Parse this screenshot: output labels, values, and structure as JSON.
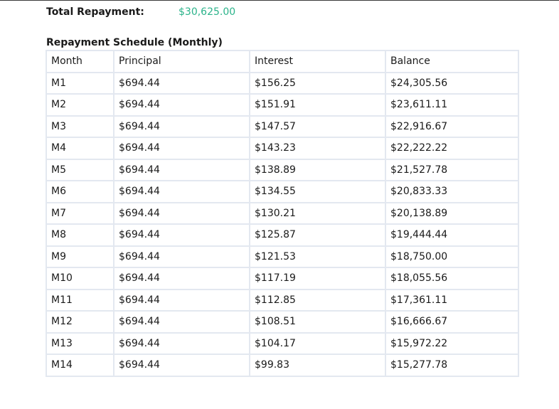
{
  "summary": {
    "total_repayment_label": "Total Repayment:",
    "total_repayment_value": "$30,625.00"
  },
  "schedule": {
    "title": "Repayment Schedule (Monthly)",
    "columns": [
      "Month",
      "Principal",
      "Interest",
      "Balance"
    ],
    "rows": [
      [
        "M1",
        "$694.44",
        "$156.25",
        "$24,305.56"
      ],
      [
        "M2",
        "$694.44",
        "$151.91",
        "$23,611.11"
      ],
      [
        "M3",
        "$694.44",
        "$147.57",
        "$22,916.67"
      ],
      [
        "M4",
        "$694.44",
        "$143.23",
        "$22,222.22"
      ],
      [
        "M5",
        "$694.44",
        "$138.89",
        "$21,527.78"
      ],
      [
        "M6",
        "$694.44",
        "$134.55",
        "$20,833.33"
      ],
      [
        "M7",
        "$694.44",
        "$130.21",
        "$20,138.89"
      ],
      [
        "M8",
        "$694.44",
        "$125.87",
        "$19,444.44"
      ],
      [
        "M9",
        "$694.44",
        "$121.53",
        "$18,750.00"
      ],
      [
        "M10",
        "$694.44",
        "$117.19",
        "$18,055.56"
      ],
      [
        "M11",
        "$694.44",
        "$112.85",
        "$17,361.11"
      ],
      [
        "M12",
        "$694.44",
        "$108.51",
        "$16,666.67"
      ],
      [
        "M13",
        "$694.44",
        "$104.17",
        "$15,972.22"
      ],
      [
        "M14",
        "$694.44",
        "$99.83",
        "$15,277.78"
      ]
    ]
  },
  "colors": {
    "accent_value": "#2bb38a",
    "table_border": "#e3e8f0"
  }
}
